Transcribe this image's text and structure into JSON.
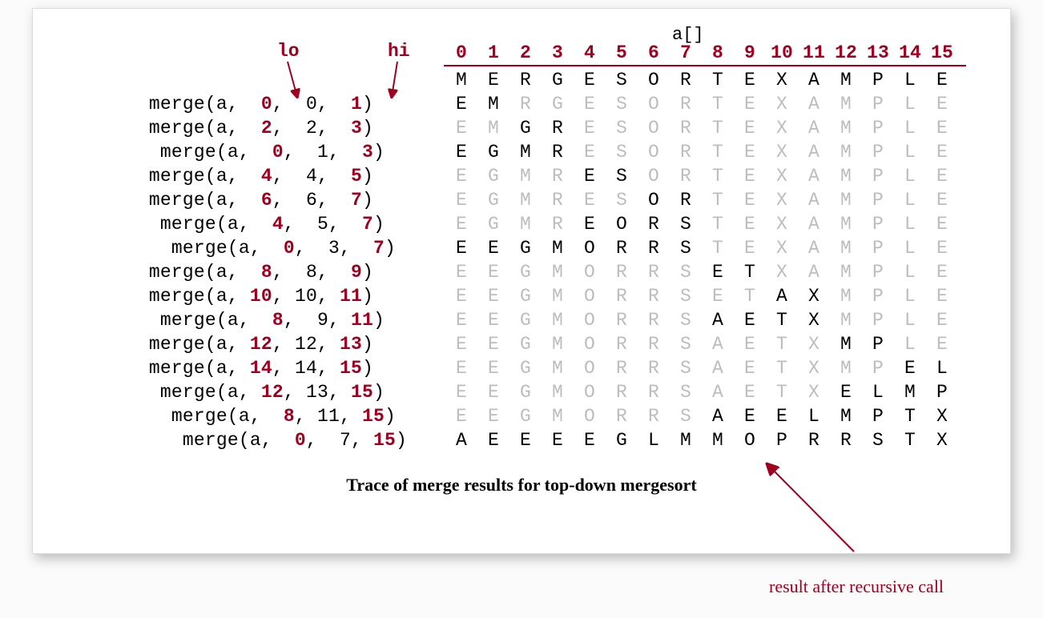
{
  "title": "Trace of merge results for top-down mergesort",
  "array_label": "a[]",
  "lo_label": "lo",
  "hi_label": "hi",
  "result_note": "result after recursive call",
  "indices": [
    0,
    1,
    2,
    3,
    4,
    5,
    6,
    7,
    8,
    9,
    10,
    11,
    12,
    13,
    14,
    15
  ],
  "initial": [
    "M",
    "E",
    "R",
    "G",
    "E",
    "S",
    "O",
    "R",
    "T",
    "E",
    "X",
    "A",
    "M",
    "P",
    "L",
    "E"
  ],
  "rows": [
    {
      "call": {
        "fn": "merge(a,",
        "lo": 0,
        "mid": 0,
        "hi": 1
      },
      "indent": 2,
      "letters": [
        "E",
        "M",
        "R",
        "G",
        "E",
        "S",
        "O",
        "R",
        "T",
        "E",
        "X",
        "A",
        "M",
        "P",
        "L",
        "E"
      ],
      "bold": [
        0,
        1
      ]
    },
    {
      "call": {
        "fn": "merge(a,",
        "lo": 2,
        "mid": 2,
        "hi": 3
      },
      "indent": 2,
      "letters": [
        "E",
        "M",
        "G",
        "R",
        "E",
        "S",
        "O",
        "R",
        "T",
        "E",
        "X",
        "A",
        "M",
        "P",
        "L",
        "E"
      ],
      "bold": [
        2,
        3
      ]
    },
    {
      "call": {
        "fn": "merge(a,",
        "lo": 0,
        "mid": 1,
        "hi": 3
      },
      "indent": 1,
      "letters": [
        "E",
        "G",
        "M",
        "R",
        "E",
        "S",
        "O",
        "R",
        "T",
        "E",
        "X",
        "A",
        "M",
        "P",
        "L",
        "E"
      ],
      "bold": [
        0,
        1,
        2,
        3
      ]
    },
    {
      "call": {
        "fn": "merge(a,",
        "lo": 4,
        "mid": 4,
        "hi": 5
      },
      "indent": 2,
      "letters": [
        "E",
        "G",
        "M",
        "R",
        "E",
        "S",
        "O",
        "R",
        "T",
        "E",
        "X",
        "A",
        "M",
        "P",
        "L",
        "E"
      ],
      "bold": [
        4,
        5
      ]
    },
    {
      "call": {
        "fn": "merge(a,",
        "lo": 6,
        "mid": 6,
        "hi": 7
      },
      "indent": 2,
      "letters": [
        "E",
        "G",
        "M",
        "R",
        "E",
        "S",
        "O",
        "R",
        "T",
        "E",
        "X",
        "A",
        "M",
        "P",
        "L",
        "E"
      ],
      "bold": [
        6,
        7
      ]
    },
    {
      "call": {
        "fn": "merge(a,",
        "lo": 4,
        "mid": 5,
        "hi": 7
      },
      "indent": 1,
      "letters": [
        "E",
        "G",
        "M",
        "R",
        "E",
        "O",
        "R",
        "S",
        "T",
        "E",
        "X",
        "A",
        "M",
        "P",
        "L",
        "E"
      ],
      "bold": [
        4,
        5,
        6,
        7
      ]
    },
    {
      "call": {
        "fn": "merge(a,",
        "lo": 0,
        "mid": 3,
        "hi": 7
      },
      "indent": 0,
      "letters": [
        "E",
        "E",
        "G",
        "M",
        "O",
        "R",
        "R",
        "S",
        "T",
        "E",
        "X",
        "A",
        "M",
        "P",
        "L",
        "E"
      ],
      "bold": [
        0,
        1,
        2,
        3,
        4,
        5,
        6,
        7
      ]
    },
    {
      "call": {
        "fn": "merge(a,",
        "lo": 8,
        "mid": 8,
        "hi": 9
      },
      "indent": 2,
      "letters": [
        "E",
        "E",
        "G",
        "M",
        "O",
        "R",
        "R",
        "S",
        "E",
        "T",
        "X",
        "A",
        "M",
        "P",
        "L",
        "E"
      ],
      "bold": [
        8,
        9
      ]
    },
    {
      "call": {
        "fn": "merge(a,",
        "lo": 10,
        "mid": 10,
        "hi": 11
      },
      "indent": 2,
      "letters": [
        "E",
        "E",
        "G",
        "M",
        "O",
        "R",
        "R",
        "S",
        "E",
        "T",
        "A",
        "X",
        "M",
        "P",
        "L",
        "E"
      ],
      "bold": [
        10,
        11
      ]
    },
    {
      "call": {
        "fn": "merge(a,",
        "lo": 8,
        "mid": 9,
        "hi": 11
      },
      "indent": 1,
      "letters": [
        "E",
        "E",
        "G",
        "M",
        "O",
        "R",
        "R",
        "S",
        "A",
        "E",
        "T",
        "X",
        "M",
        "P",
        "L",
        "E"
      ],
      "bold": [
        8,
        9,
        10,
        11
      ]
    },
    {
      "call": {
        "fn": "merge(a,",
        "lo": 12,
        "mid": 12,
        "hi": 13
      },
      "indent": 2,
      "letters": [
        "E",
        "E",
        "G",
        "M",
        "O",
        "R",
        "R",
        "S",
        "A",
        "E",
        "T",
        "X",
        "M",
        "P",
        "L",
        "E"
      ],
      "bold": [
        12,
        13
      ]
    },
    {
      "call": {
        "fn": "merge(a,",
        "lo": 14,
        "mid": 14,
        "hi": 15
      },
      "indent": 2,
      "letters": [
        "E",
        "E",
        "G",
        "M",
        "O",
        "R",
        "R",
        "S",
        "A",
        "E",
        "T",
        "X",
        "M",
        "P",
        "E",
        "L"
      ],
      "bold": [
        14,
        15
      ]
    },
    {
      "call": {
        "fn": "merge(a,",
        "lo": 12,
        "mid": 13,
        "hi": 15
      },
      "indent": 1,
      "letters": [
        "E",
        "E",
        "G",
        "M",
        "O",
        "R",
        "R",
        "S",
        "A",
        "E",
        "T",
        "X",
        "E",
        "L",
        "M",
        "P"
      ],
      "bold": [
        12,
        13,
        14,
        15
      ]
    },
    {
      "call": {
        "fn": "merge(a,",
        "lo": 8,
        "mid": 11,
        "hi": 15
      },
      "indent": 0,
      "letters": [
        "E",
        "E",
        "G",
        "M",
        "O",
        "R",
        "R",
        "S",
        "A",
        "E",
        "E",
        "L",
        "M",
        "P",
        "T",
        "X"
      ],
      "bold": [
        8,
        9,
        10,
        11,
        12,
        13,
        14,
        15
      ]
    },
    {
      "call": {
        "fn": "merge(a,",
        "lo": 0,
        "mid": 7,
        "hi": 15
      },
      "indent": -1,
      "letters": [
        "A",
        "E",
        "E",
        "E",
        "E",
        "G",
        "L",
        "M",
        "M",
        "O",
        "P",
        "R",
        "R",
        "S",
        "T",
        "X"
      ],
      "bold": [
        0,
        1,
        2,
        3,
        4,
        5,
        6,
        7,
        8,
        9,
        10,
        11,
        12,
        13,
        14,
        15
      ]
    }
  ]
}
